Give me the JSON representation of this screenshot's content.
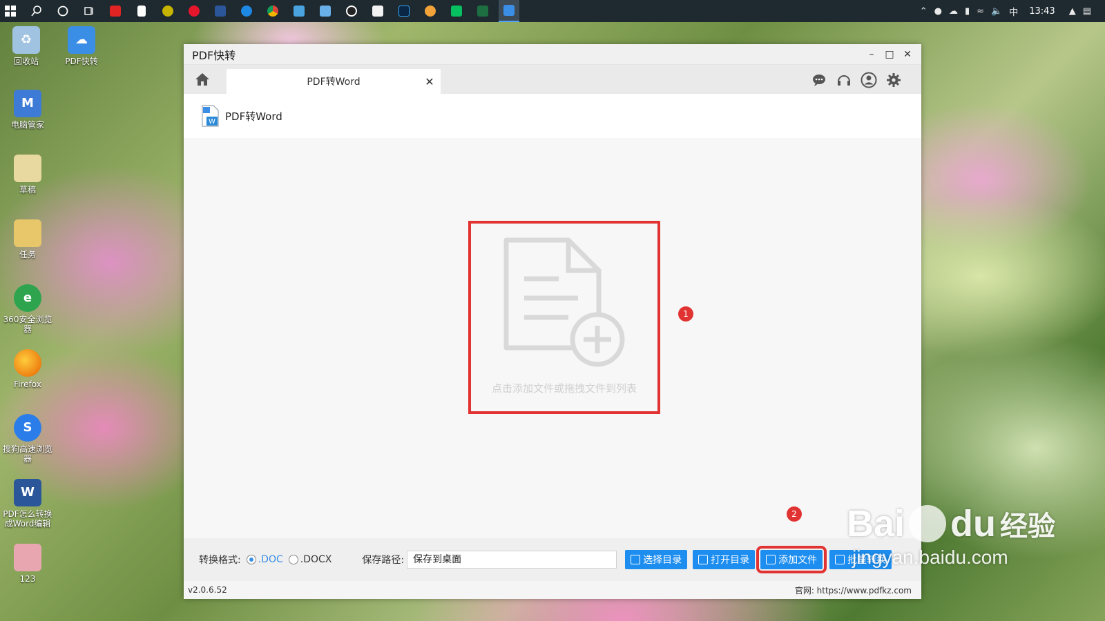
{
  "taskbar": {
    "icons": [
      "windows-start-icon",
      "search-icon",
      "cortana-icon",
      "task-view-icon",
      "app-icon",
      "document-icon",
      "app-icon",
      "weibo-icon",
      "word-icon",
      "edge-icon",
      "chrome-icon",
      "app-icon",
      "app-icon",
      "qq-icon",
      "app-icon",
      "photoshop-icon",
      "app-icon",
      "wechat-icon",
      "excel-icon",
      "pdf-kuaizhuan-taskbar-icon"
    ],
    "tray": {
      "ime": "中",
      "clock": "13:43"
    }
  },
  "desktop": {
    "icons": [
      {
        "label": "回收站",
        "icon": "recycle-bin-icon",
        "color": "#7fb0d8"
      },
      {
        "label": "PDF快转",
        "icon": "pdf-kuaizhuan-icon",
        "color": "#3a8ee6"
      },
      {
        "label": "电脑管家",
        "icon": "pc-manager-icon",
        "color": "#3d7bd6"
      },
      {
        "label": "草稿",
        "icon": "folder-icon",
        "color": "#e8c66a"
      },
      {
        "label": "任务",
        "icon": "folder-icon",
        "color": "#e8c66a"
      },
      {
        "label": "360安全浏览器",
        "icon": "360-browser-icon",
        "color": "#2ea44f"
      },
      {
        "label": "Firefox",
        "icon": "firefox-icon",
        "color": "#e66000"
      },
      {
        "label": "搜狗高速浏览器",
        "icon": "sogou-browser-icon",
        "color": "#2b7de9"
      },
      {
        "label": "PDF怎么转换成Word编辑",
        "icon": "word-doc-icon",
        "color": "#2b579a"
      },
      {
        "label": "123",
        "icon": "folder-icon",
        "color": "#e8c66a"
      }
    ]
  },
  "window": {
    "title": "PDF快转",
    "tab_label": "PDF转Word",
    "content_title": "PDF转Word",
    "drop_hint": "点击添加文件或拖拽文件到列表",
    "badge_1": "1",
    "badge_2": "2",
    "format_label": "转换格式:",
    "format_options": [
      ".DOC",
      ".DOCX"
    ],
    "selected_format": ".DOC",
    "save_path_label": "保存路径:",
    "save_path_value": "保存到桌面",
    "buttons": {
      "choose_dir": "选择目录",
      "open_dir": "打开目录",
      "add_file": "添加文件",
      "batch_convert": "批量转换"
    },
    "version": "v2.0.6.52",
    "website": "官网: https://www.pdfkz.com"
  },
  "watermark": {
    "brand": "Bai",
    "brand_suffix": "du",
    "jingyan": "经验",
    "url": "jingyan.baidu.com"
  },
  "colors": {
    "accent": "#1d8ef0",
    "highlight": "#e23333"
  }
}
